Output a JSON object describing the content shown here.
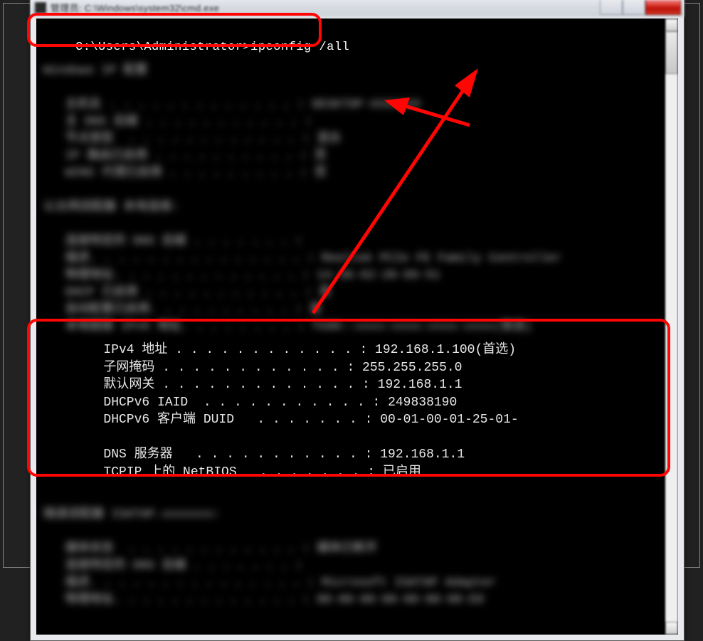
{
  "window": {
    "title": "管理员: C:\\Windows\\system32\\cmd.exe",
    "buttons": {
      "minimize": "–",
      "maximize": "▢",
      "close": "✕"
    }
  },
  "command": {
    "line": "C:\\Users\\Administrator>ipconfig /all"
  },
  "network": {
    "rows": [
      {
        "label": "IPv4 地址",
        "dots": ". . . . . . . . . . . . :",
        "value": "192.168.1.100(首选)"
      },
      {
        "label": "子网掩码",
        "dots": ". . . . . . . . . . . . :",
        "value": "255.255.255.0"
      },
      {
        "label": "默认网关",
        "dots": ". . . . . . . . . . . . . :",
        "value": "192.168.1.1"
      },
      {
        "label": "DHCPv6 IAID",
        "dots": " . . . . . . . . . . . :",
        "value": "249838190"
      },
      {
        "label": "DHCPv6 客户端 DUID",
        "dots": "  . . . . . . . :",
        "value": "00-01-00-01-25-01-"
      },
      {
        "blank": true
      },
      {
        "label": "DNS 服务器",
        "dots": "  . . . . . . . . . . . :",
        "value": "192.168.1.1"
      },
      {
        "label": "TCPIP 上的 NetBIOS",
        "dots": "  . . . . . . . :",
        "value": "已启用"
      }
    ]
  },
  "blurred": {
    "lines": [
      "",
      "",
      "Windows IP 配置",
      "",
      "   主机名 . . . . . . . . . . . . . : DESKTOP-XXXXXXX",
      "   主 DNS 后缀 . . . . . . . . . . . :",
      "   节点类型  . . . . . . . . . . . . : 混合",
      "   IP 路由已启用 . . . . . . . . . . : 否",
      "   WINS 代理已启用 . . . . . . . . . : 否",
      "",
      "以太网适配器 本地连接:",
      "",
      "   连接特定的 DNS 后缀 . . . . . . . :",
      "   描述. . . . . . . . . . . . . . . : Realtek PCIe FE Family Controller",
      "   物理地址. . . . . . . . . . . . . : 14-30-62-20-89-51",
      "   DHCP 已启用 . . . . . . . . . . . : 是",
      "   自动配置已启用. . . . . . . . . . : 是",
      "   本地链接 IPv6 地址. . . . . . . . : fe80::xxxx:xxxx:xxxx:xxxx(首选)",
      "",
      "",
      "",
      "",
      "",
      "",
      "",
      "",
      "",
      "",
      "隧道适配器 ISATAP.xxxxxxx:",
      "",
      "   媒体状态  . . . . . . . . . . . . : 媒体已断开",
      "   连接特定的 DNS 后缀 . . . . . . . :",
      "   描述. . . . . . . . . . . . . . . : Microsoft ISATAP Adapter",
      "   物理地址. . . . . . . . . . . . . : 00-00-00-00-00-00-00-E0"
    ]
  }
}
